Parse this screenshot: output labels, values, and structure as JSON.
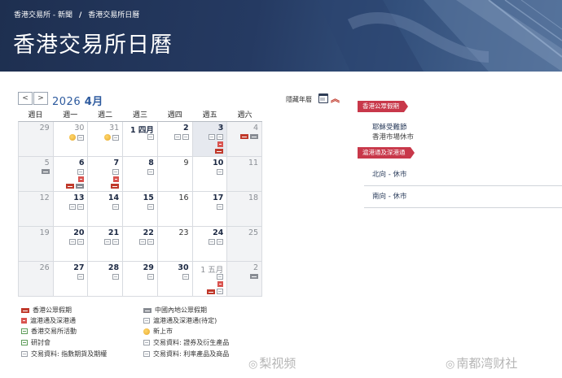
{
  "breadcrumb": {
    "home": "香港交易所 - 新聞",
    "current": "香港交易所日曆"
  },
  "title": "香港交易所日曆",
  "calendar": {
    "prev_label": "<",
    "next_label": ">",
    "year": "2026",
    "month": "4月",
    "collapse_label": "隱藏年曆",
    "weekdays": [
      "週日",
      "週一",
      "週二",
      "週三",
      "週四",
      "週五",
      "週六"
    ],
    "weeks": [
      [
        {
          "label": "29",
          "other": true,
          "icons": []
        },
        {
          "label": "30",
          "other": true,
          "icons": [
            [
              "ipo",
              "gen"
            ]
          ]
        },
        {
          "label": "31",
          "other": true,
          "icons": [
            [
              "ipo",
              "gen"
            ]
          ]
        },
        {
          "label": "1 四月",
          "bold": true,
          "icons": [
            [
              "gen"
            ]
          ]
        },
        {
          "label": "2",
          "bold": true,
          "icons": [
            [
              "gen",
              "gen"
            ]
          ]
        },
        {
          "label": "3",
          "bold": true,
          "today": true,
          "icons": [
            [
              "gen",
              "gen"
            ],
            [
              "sc"
            ],
            [
              "hk"
            ]
          ]
        },
        {
          "label": "4",
          "icons": [
            [
              "hk",
              "cn"
            ]
          ]
        }
      ],
      [
        {
          "label": "5",
          "icons": [
            [
              "cn"
            ]
          ]
        },
        {
          "label": "6",
          "bold": true,
          "icons": [
            [
              "gen"
            ],
            [
              "sc"
            ],
            [
              "hk",
              "cn"
            ]
          ]
        },
        {
          "label": "7",
          "bold": true,
          "icons": [
            [
              "gen"
            ],
            [
              "sc"
            ],
            [
              "hk"
            ]
          ]
        },
        {
          "label": "8",
          "bold": true,
          "icons": [
            [
              "gen"
            ]
          ]
        },
        {
          "label": "9",
          "icons": []
        },
        {
          "label": "10",
          "bold": true,
          "icons": [
            [
              "gen"
            ]
          ]
        },
        {
          "label": "11",
          "icons": []
        }
      ],
      [
        {
          "label": "12",
          "icons": []
        },
        {
          "label": "13",
          "bold": true,
          "icons": [
            [
              "gen",
              "gen"
            ]
          ]
        },
        {
          "label": "14",
          "bold": true,
          "icons": [
            [
              "gen"
            ]
          ]
        },
        {
          "label": "15",
          "bold": true,
          "icons": [
            [
              "gen"
            ]
          ]
        },
        {
          "label": "16",
          "icons": []
        },
        {
          "label": "17",
          "bold": true,
          "icons": [
            [
              "gen"
            ]
          ]
        },
        {
          "label": "18",
          "icons": []
        }
      ],
      [
        {
          "label": "19",
          "icons": []
        },
        {
          "label": "20",
          "bold": true,
          "icons": [
            [
              "gen",
              "gen"
            ]
          ]
        },
        {
          "label": "21",
          "bold": true,
          "icons": [
            [
              "gen",
              "gen"
            ]
          ]
        },
        {
          "label": "22",
          "bold": true,
          "icons": [
            [
              "gen",
              "gen"
            ]
          ]
        },
        {
          "label": "23",
          "icons": []
        },
        {
          "label": "24",
          "bold": true,
          "icons": [
            [
              "gen",
              "gen"
            ]
          ]
        },
        {
          "label": "25",
          "icons": []
        }
      ],
      [
        {
          "label": "26",
          "icons": []
        },
        {
          "label": "27",
          "bold": true,
          "icons": [
            [
              "gen"
            ]
          ]
        },
        {
          "label": "28",
          "bold": true,
          "icons": [
            [
              "gen"
            ]
          ]
        },
        {
          "label": "29",
          "bold": true,
          "icons": [
            [
              "gen"
            ]
          ]
        },
        {
          "label": "30",
          "bold": true,
          "icons": [
            [
              "gen"
            ]
          ]
        },
        {
          "label": "1 五月",
          "other": true,
          "icons": [
            [
              "gen"
            ],
            [
              "sc"
            ],
            [
              "hk",
              "gen"
            ]
          ]
        },
        {
          "label": "2",
          "other": true,
          "icons": [
            [
              "cn"
            ]
          ]
        }
      ]
    ]
  },
  "legend": {
    "hk_holiday": "香港公眾假期",
    "sc": "滬港通及深港通",
    "hkex_event": "香港交易所活動",
    "seminar": "研討會",
    "index_data": "交易資料: 指數期貨及期權",
    "cn_holiday": "中國內地公眾假期",
    "sc_pending": "滬港通及深港通(待定)",
    "ipo": "新上市",
    "bond_data": "交易資料: 證券及衍生產品",
    "rate_data": "交易資料: 利率產品及商品"
  },
  "panel": {
    "tag_holiday": "香港公眾假期",
    "holiday_name": "耶穌受難節",
    "holiday_note": "香港市場休市",
    "tag_sc": "滬港通及深港通",
    "northbound": "北向 - 休市",
    "southbound": "南向 - 休市"
  },
  "watermarks": {
    "left": "梨视频",
    "right": "南都湾财社"
  }
}
